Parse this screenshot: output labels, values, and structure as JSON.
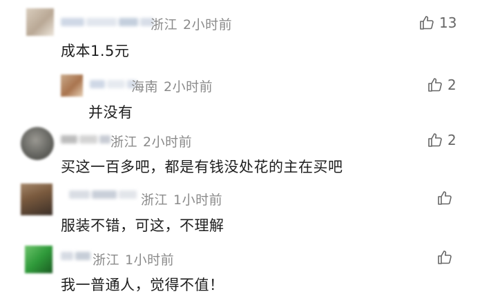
{
  "comments": [
    {
      "region": "浙江",
      "time": "2小时前",
      "text": "成本1.5元",
      "likes": "13",
      "avatar_colors": [
        "#d9cdbd",
        "#b9a895",
        "#ede6dc"
      ]
    },
    {
      "region": "海南",
      "time": "2小时前",
      "text": "并没有",
      "likes": "2",
      "avatar_colors": [
        "#c9a98a",
        "#a9744e",
        "#e6cdb2"
      ]
    },
    {
      "region": "浙江",
      "time": "2小时前",
      "text": "买这一百多吧，都是有钱没处花的主在买吧",
      "likes": "2",
      "avatar_colors": [
        "#6f6f6a",
        "#3f3f3b",
        "#9a9892"
      ]
    },
    {
      "region": "浙江",
      "time": "1小时前",
      "text": "服装不错，可这，不理解",
      "likes": "",
      "avatar_colors": [
        "#7a5a3e",
        "#3b2f27",
        "#a4876a"
      ]
    },
    {
      "region": "浙江",
      "time": "1小时前",
      "text": "我一普通人，觉得不值！",
      "likes": "",
      "avatar_colors": [
        "#2f9a3a",
        "#1b5c22",
        "#6cc36b"
      ]
    }
  ],
  "icons": {
    "like": "thumbs-up-icon"
  },
  "colors": {
    "meta": "#8a8a8a",
    "text": "#1e1e1e",
    "icon": "#666666"
  }
}
